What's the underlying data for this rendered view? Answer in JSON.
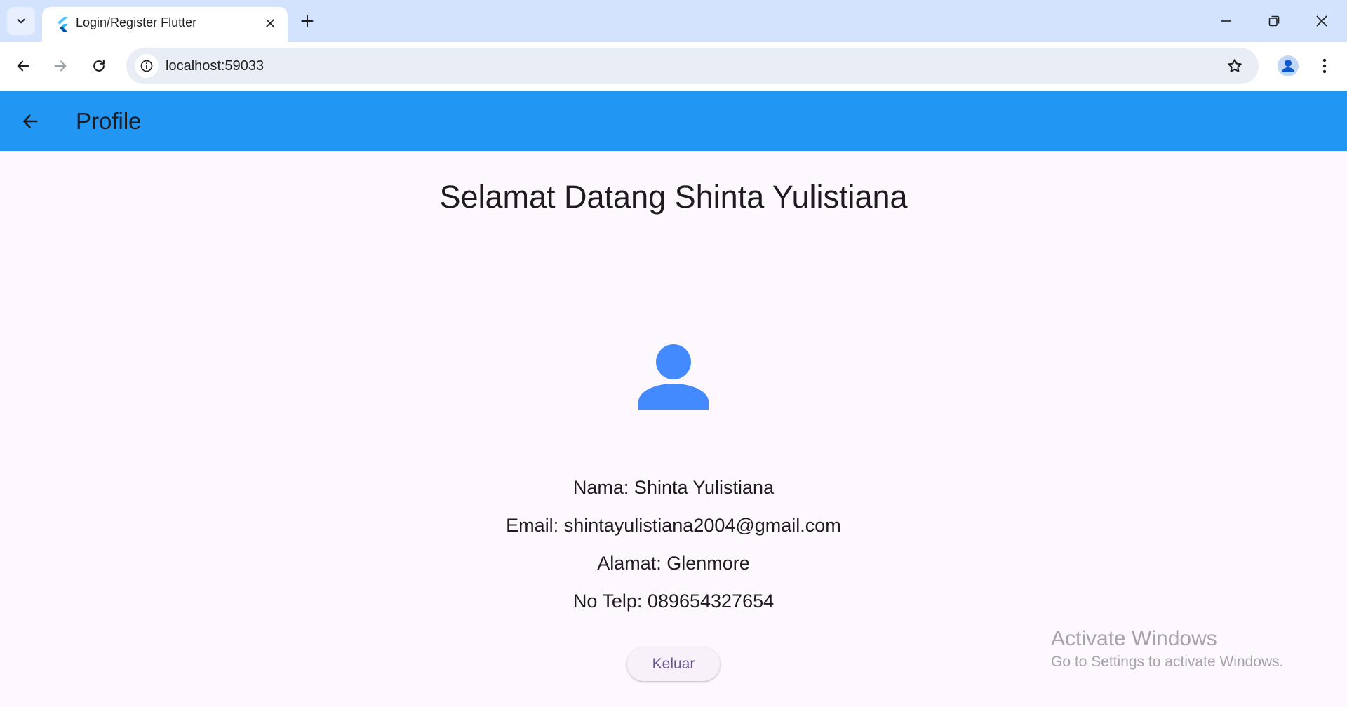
{
  "browser": {
    "tab_title": "Login/Register Flutter",
    "url": "localhost:59033",
    "icons": {
      "tab_search": "chevron-down-icon",
      "favicon": "flutter-icon",
      "tab_close": "close-icon",
      "new_tab": "plus-icon",
      "back": "arrow-left-icon",
      "forward": "arrow-right-icon",
      "reload": "reload-icon",
      "site_info": "info-icon",
      "bookmark": "star-icon",
      "profile": "person-icon",
      "menu": "vertical-dots-icon",
      "minimize": "minimize-icon",
      "restore": "restore-icon",
      "close_window": "close-icon"
    }
  },
  "appbar": {
    "title": "Profile",
    "back_icon": "arrow-left-icon",
    "color": "#2196f3"
  },
  "profile": {
    "welcome": "Selamat Datang Shinta Yulistiana",
    "avatar_icon": "person-icon",
    "avatar_color": "#448aff",
    "name_line": "Nama: Shinta Yulistiana",
    "email_line": "Email: shintayulistiana2004@gmail.com",
    "address_line": "Alamat: Glenmore",
    "phone_line": "No Telp: 089654327654",
    "logout_label": "Keluar"
  },
  "watermark": {
    "title": "Activate Windows",
    "subtitle": "Go to Settings to activate Windows."
  }
}
